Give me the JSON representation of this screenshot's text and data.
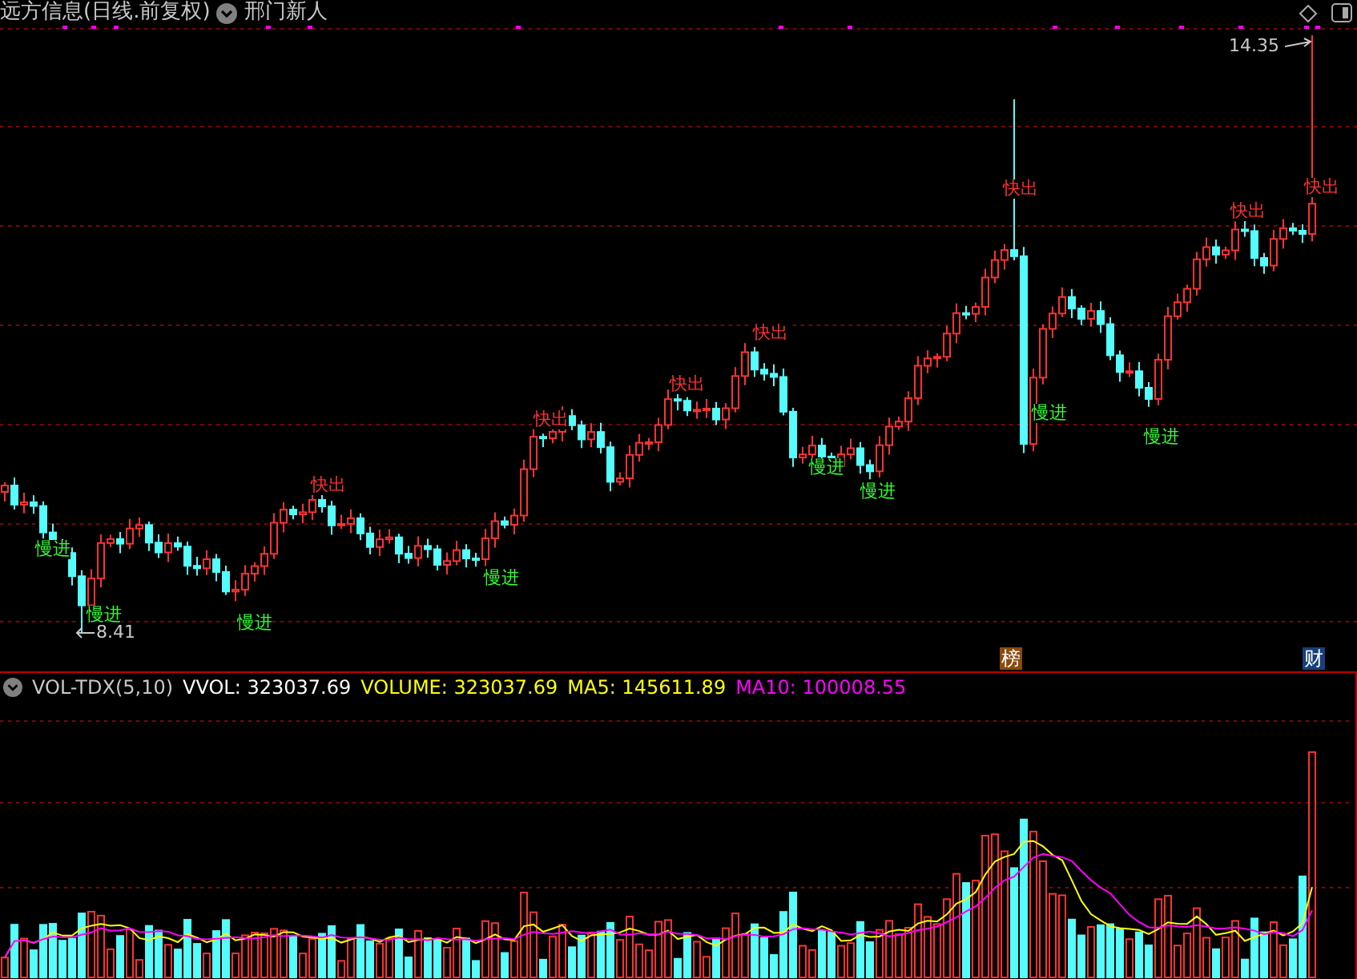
{
  "header": {
    "title": "远方信息(日线.前复权)",
    "indicator": "邢门新人"
  },
  "price_chart": {
    "high_label": "14.35",
    "low_label": "8.41",
    "signals": [
      {
        "text": "慢进",
        "kind": "buy"
      },
      {
        "text": "慢进",
        "kind": "buy"
      },
      {
        "text": "慢进",
        "kind": "buy"
      },
      {
        "text": "快出",
        "kind": "sell"
      },
      {
        "text": "慢进",
        "kind": "buy"
      },
      {
        "text": "快出",
        "kind": "sell"
      },
      {
        "text": "快出",
        "kind": "sell"
      },
      {
        "text": "快出",
        "kind": "sell"
      },
      {
        "text": "慢进",
        "kind": "buy"
      },
      {
        "text": "慢进",
        "kind": "buy"
      },
      {
        "text": "快出",
        "kind": "sell"
      },
      {
        "text": "慢进",
        "kind": "buy"
      },
      {
        "text": "慢进",
        "kind": "buy"
      },
      {
        "text": "快出",
        "kind": "sell"
      },
      {
        "text": "快出",
        "kind": "sell"
      }
    ],
    "badges": [
      {
        "text": "榜",
        "color": "#8b4a0c"
      },
      {
        "text": "财",
        "color": "#173f7a"
      }
    ]
  },
  "volume_panel": {
    "legend": [
      {
        "text": "VOL-TDX(5,10)",
        "color": "#c8c8c8"
      },
      {
        "text": "VVOL: 323037.69",
        "color": "#ffffff"
      },
      {
        "text": "VOLUME: 323037.69",
        "color": "#ffff00"
      },
      {
        "text": "MA5: 145611.89",
        "color": "#ffff00"
      },
      {
        "text": "MA10: 100008.55",
        "color": "#ff00ff"
      }
    ]
  }
}
